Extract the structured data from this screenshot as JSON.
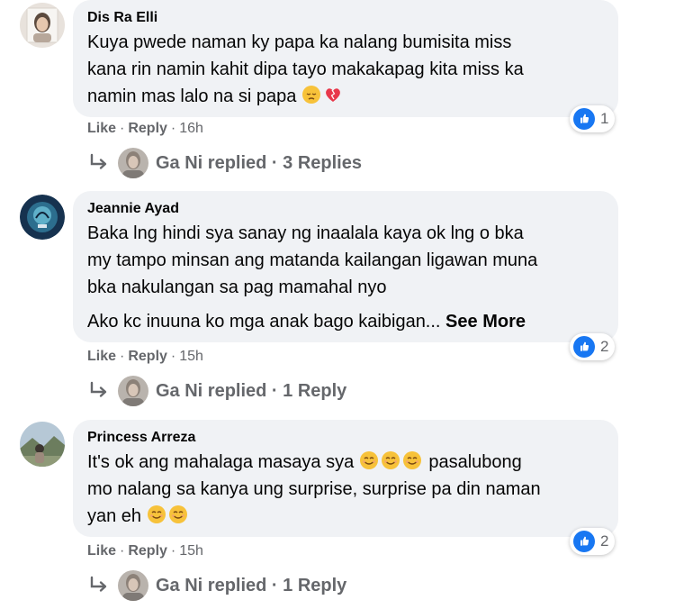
{
  "comments": [
    {
      "author": "Dis Ra Elli",
      "lines": [
        "Kuya pwede naman ky papa ka nalang bumisita miss",
        "kana rin namin kahit dipa tayo makakapag kita miss ka",
        "namin mas lalo na si papa"
      ],
      "reaction_count": "1",
      "like": "Like",
      "reply": "Reply",
      "time": "16h",
      "replies_text": "Ga Ni replied · 3 Replies"
    },
    {
      "author": "Jeannie Ayad",
      "lines": [
        "Baka lng hindi sya sanay ng inaalala kaya ok lng o bka",
        "my tampo minsan ang matanda kailangan ligawan muna",
        "bka nakulangan sa pag mamahal nyo"
      ],
      "extra_line": "Ako kc inuuna ko mga anak bago kaibigan...",
      "see_more": "See More",
      "reaction_count": "2",
      "like": "Like",
      "reply": "Reply",
      "time": "15h",
      "replies_text": "Ga Ni replied · 1 Reply"
    },
    {
      "author": "Princess Arreza",
      "lines": [
        "It's ok ang mahalaga masaya sya",
        "mo nalang sa kanya ung surprise, surprise pa din naman",
        "yan eh"
      ],
      "line1_tail": "pasalubong",
      "reaction_count": "2",
      "like": "Like",
      "reply": "Reply",
      "time": "15h",
      "replies_text": "Ga Ni replied · 1 Reply"
    }
  ],
  "separator": "·",
  "colors": {
    "bubble": "#f0f2f5",
    "like_blue": "#1877f2",
    "meta_gray": "#65676b"
  },
  "icons": {
    "reaction": "like-thumb-icon",
    "reply": "reply-arrow-icon",
    "emoji_sad": "pensive-face-icon",
    "emoji_heart": "heart-icon",
    "emoji_smile": "smiling-face-icon"
  }
}
